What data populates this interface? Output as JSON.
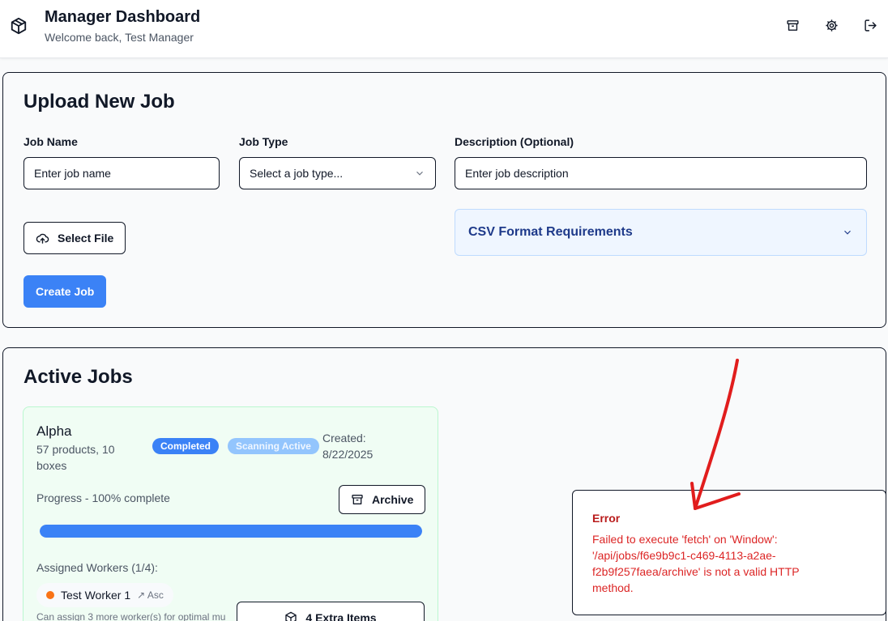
{
  "header": {
    "title": "Manager Dashboard",
    "subtitle": "Welcome back, Test Manager",
    "icons": [
      "package-icon",
      "archive-icon",
      "settings-icon",
      "logout-icon"
    ]
  },
  "upload": {
    "heading": "Upload New Job",
    "job_name_label": "Job Name",
    "job_name_placeholder": "Enter job name",
    "job_type_label": "Job Type",
    "job_type_selected": "Select a job type...",
    "description_label": "Description (Optional)",
    "description_placeholder": "Enter job description",
    "select_file_label": "Select File",
    "csv_requirements_label": "CSV Format Requirements",
    "create_label": "Create Job"
  },
  "active": {
    "heading": "Active Jobs",
    "jobs": [
      {
        "name": "Alpha",
        "meta": "57 products, 10 boxes",
        "status_badge": "Completed",
        "scan_badge": "Scanning Active",
        "created": "Created: 8/22/2025",
        "progress_label": "Progress - 100% complete",
        "progress": 1.0,
        "archive_label": "Archive",
        "workers_label": "Assigned Workers (1/4):",
        "workers": [
          {
            "name": "Test Worker 1",
            "role": "↗ Asc"
          }
        ],
        "extra_items_label": "4 Extra Items",
        "assign_note": "Can assign 3 more worker(s) for optimal mu"
      }
    ]
  },
  "toast": {
    "title": "Error",
    "message": "Failed to execute 'fetch' on 'Window': '/api/jobs/f6e9b9c1-c469-4113-a2ae-f2b9f257faea/archive' is not a valid HTTP method."
  },
  "colors": {
    "primary": "#3b82f6",
    "error": "#dc2626",
    "job_card_bg": "#f0fdf4",
    "csv_box_bg": "#eff6ff",
    "annotation_arrow": "#e11d1d"
  }
}
